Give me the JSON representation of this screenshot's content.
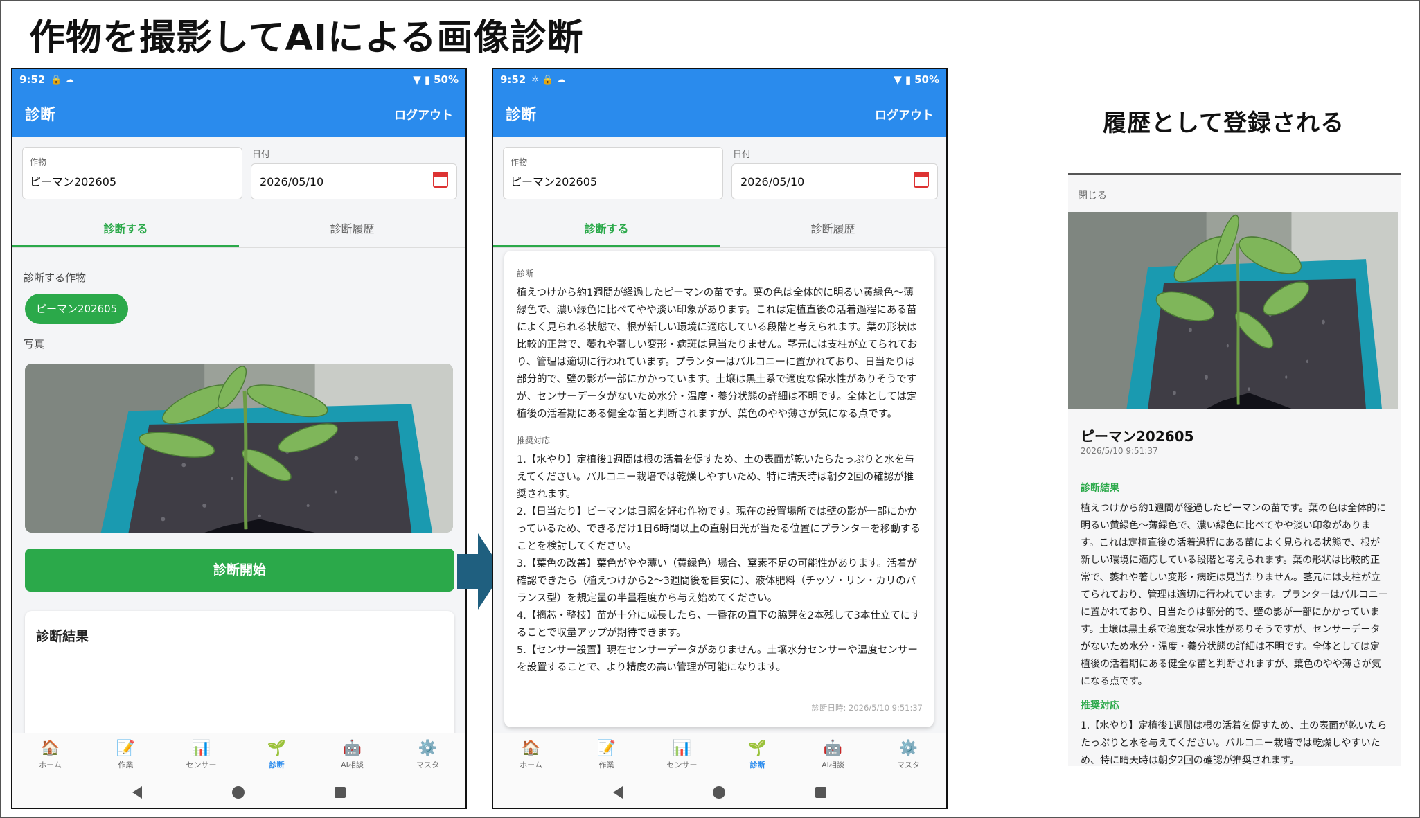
{
  "slide": {
    "title": "作物を撮影してAIによる画像診断",
    "history_title": "履歴として登録される"
  },
  "status": {
    "time": "9:52",
    "battery": "50%"
  },
  "appbar": {
    "title": "診断",
    "logout": "ログアウト"
  },
  "form": {
    "crop_label": "作物",
    "crop_value": "ピーマン202605",
    "date_label": "日付",
    "date_value": "2026/05/10"
  },
  "tabs": [
    "診断する",
    "診断履歴"
  ],
  "phone1": {
    "crop_section_label": "診断する作物",
    "crop_chip": "ピーマン202605",
    "photo_label": "写真",
    "start_button": "診断開始",
    "result_title": "診断結果"
  },
  "phone2": {
    "diagnosis_label": "診断",
    "diagnosis_text": "植えつけから約1週間が経過したピーマンの苗です。葉の色は全体的に明るい黄緑色〜薄緑色で、濃い緑色に比べてやや淡い印象があります。これは定植直後の活着過程にある苗によく見られる状態で、根が新しい環境に適応している段階と考えられます。葉の形状は比較的正常で、萎れや著しい変形・病斑は見当たりません。茎元には支柱が立てられており、管理は適切に行われています。プランターはバルコニーに置かれており、日当たりは部分的で、壁の影が一部にかかっています。土壌は黒土系で適度な保水性がありそうですが、センサーデータがないため水分・温度・養分状態の詳細は不明です。全体としては定植後の活着期にある健全な苗と判断されますが、葉色のやや薄さが気になる点です。",
    "recommend_label": "推奨対応",
    "recommendations": [
      "1.【水やり】定植後1週間は根の活着を促すため、土の表面が乾いたらたっぷりと水を与えてください。バルコニー栽培では乾燥しやすいため、特に晴天時は朝夕2回の確認が推奨されます。",
      "2.【日当たり】ピーマンは日照を好む作物です。現在の設置場所では壁の影が一部にかかっているため、できるだけ1日6時間以上の直射日光が当たる位置にプランターを移動することを検討してください。",
      "3.【葉色の改善】葉色がやや薄い（黄緑色）場合、窒素不足の可能性があります。活着が確認できたら（植えつけから2〜3週間後を目安に）、液体肥料（チッソ・リン・カリのバランス型）を規定量の半量程度から与え始めてください。",
      "4.【摘芯・整枝】苗が十分に成長したら、一番花の直下の脇芽を2本残して3本仕立てにすることで収量アップが期待できます。",
      "5.【センサー設置】現在センサーデータがありません。土壌水分センサーや温度センサーを設置することで、より精度の高い管理が可能になります。"
    ],
    "diagnosis_date": "診断日時: 2026/5/10 9:51:37"
  },
  "nav": [
    {
      "label": "ホーム",
      "icon": "home-icon",
      "glyph": "🏠"
    },
    {
      "label": "作業",
      "icon": "memo-icon",
      "glyph": "📝"
    },
    {
      "label": "センサー",
      "icon": "chart-icon",
      "glyph": "📊"
    },
    {
      "label": "診断",
      "icon": "seedling-icon",
      "glyph": "🌱"
    },
    {
      "label": "AI相談",
      "icon": "robot-icon",
      "glyph": "🤖"
    },
    {
      "label": "マスタ",
      "icon": "gear-icon",
      "glyph": "⚙️"
    }
  ],
  "history": {
    "close": "閉じる",
    "name": "ピーマン202605",
    "date": "2026/5/10 9:51:37",
    "result_label": "診断結果",
    "result_text": "植えつけから約1週間が経過したピーマンの苗です。葉の色は全体的に明るい黄緑色〜薄緑色で、濃い緑色に比べてやや淡い印象があります。これは定植直後の活着過程にある苗によく見られる状態で、根が新しい環境に適応している段階と考えられます。葉の形状は比較的正常で、萎れや著しい変形・病斑は見当たりません。茎元には支柱が立てられており、管理は適切に行われています。プランターはバルコニーに置かれており、日当たりは部分的で、壁の影が一部にかかっています。土壌は黒土系で適度な保水性がありそうですが、センサーデータがないため水分・温度・養分状態の詳細は不明です。全体としては定植後の活着期にある健全な苗と判断されますが、葉色のやや薄さが気になる点です。",
    "recommend_label": "推奨対応",
    "recommend_text": "1.【水やり】定植後1週間は根の活着を促すため、土の表面が乾いたらたっぷりと水を与えてください。バルコニー栽培では乾燥しやすいため、特に晴天時は朝夕2回の確認が推奨されます。"
  },
  "colors": {
    "appbar": "#2a8bed",
    "accent": "#2ba94a",
    "arrow": "#1f5f7f"
  }
}
